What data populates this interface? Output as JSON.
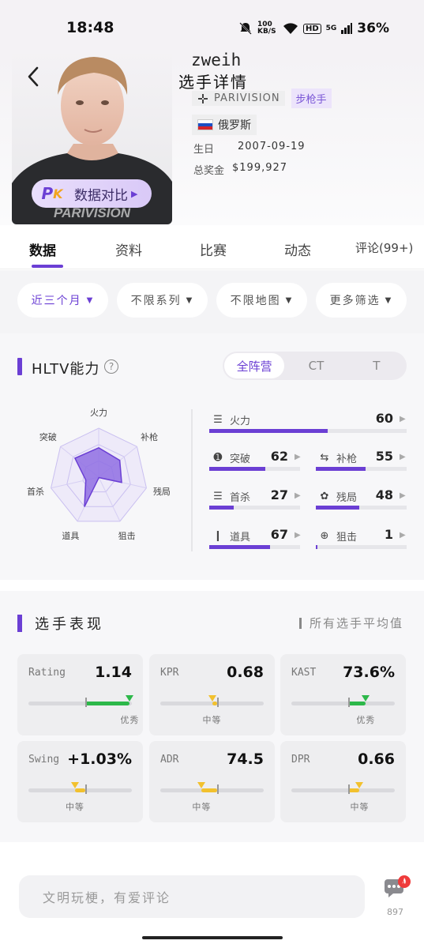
{
  "status": {
    "time": "18:48",
    "net_speed": "100 KB/S",
    "hd": "HD",
    "signal": "5G",
    "battery": "36%"
  },
  "player": {
    "handle": "zweih",
    "page_title": "选手详情",
    "team": "PARIVISION",
    "role": "步枪手",
    "country": "俄罗斯",
    "birth_label": "生日",
    "birth": "2007-09-19",
    "prize_label": "总奖金",
    "prize": "$199,927",
    "compare_label": "数据对比",
    "photo_team_text": "PARIVISION"
  },
  "tabs": [
    {
      "label": "数据",
      "active": true
    },
    {
      "label": "资料",
      "active": false
    },
    {
      "label": "比赛",
      "active": false
    },
    {
      "label": "动态",
      "active": false
    },
    {
      "label": "评论(99+)",
      "active": false
    }
  ],
  "filters": [
    {
      "label": "近三个月",
      "active": true
    },
    {
      "label": "不限系列",
      "active": false
    },
    {
      "label": "不限地图",
      "active": false
    },
    {
      "label": "更多筛选",
      "active": false
    }
  ],
  "hltv": {
    "title": "HLTV能力",
    "help": "?",
    "sides": [
      {
        "label": "全阵营",
        "active": true
      },
      {
        "label": "CT",
        "active": false
      },
      {
        "label": "T",
        "active": false
      }
    ],
    "radar_axes": [
      "火力",
      "补枪",
      "残局",
      "狙击",
      "道具",
      "首杀",
      "突破"
    ],
    "stats": [
      {
        "icon": "firepower-icon",
        "label": "火力",
        "value": 60
      },
      {
        "icon": "entrying-icon",
        "label": "突破",
        "value": 62
      },
      {
        "icon": "trading-icon",
        "label": "补枪",
        "value": 55
      },
      {
        "icon": "opening-icon",
        "label": "首杀",
        "value": 27
      },
      {
        "icon": "clutching-icon",
        "label": "残局",
        "value": 48
      },
      {
        "icon": "utility-icon",
        "label": "道具",
        "value": 67
      },
      {
        "icon": "sniping-icon",
        "label": "狙击",
        "value": 1
      }
    ]
  },
  "performance": {
    "title": "选手表现",
    "note": "所有选手平均值",
    "cards": [
      {
        "label": "Rating",
        "value": "1.14",
        "grade": "优秀",
        "color": "#2db84a",
        "level": 0.98
      },
      {
        "label": "KPR",
        "value": "0.68",
        "grade": "中等",
        "color": "#f2c12e",
        "level": 0.5
      },
      {
        "label": "KAST",
        "value": "73.6%",
        "grade": "优秀",
        "color": "#2db84a",
        "level": 0.72
      },
      {
        "label": "Swing",
        "value": "+1.03%",
        "grade": "中等",
        "color": "#f2c12e",
        "level": 0.45
      },
      {
        "label": "ADR",
        "value": "74.5",
        "grade": "中等",
        "color": "#f2c12e",
        "level": 0.4
      },
      {
        "label": "DPR",
        "value": "0.66",
        "grade": "中等",
        "color": "#f2c12e",
        "level": 0.66
      }
    ]
  },
  "comment": {
    "placeholder": "文明玩梗，有爱评论",
    "count": "897"
  },
  "colors": {
    "accent": "#6b3fd4"
  }
}
